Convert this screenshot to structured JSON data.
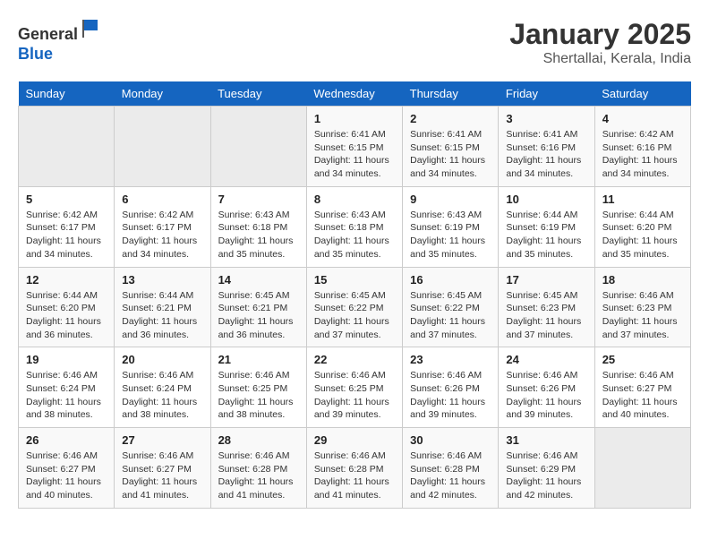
{
  "header": {
    "logo_line1": "General",
    "logo_line2": "Blue",
    "month_title": "January 2025",
    "subtitle": "Shertallai, Kerala, India"
  },
  "days_of_week": [
    "Sunday",
    "Monday",
    "Tuesday",
    "Wednesday",
    "Thursday",
    "Friday",
    "Saturday"
  ],
  "weeks": [
    [
      {
        "day": "",
        "sunrise": "",
        "sunset": "",
        "daylight": ""
      },
      {
        "day": "",
        "sunrise": "",
        "sunset": "",
        "daylight": ""
      },
      {
        "day": "",
        "sunrise": "",
        "sunset": "",
        "daylight": ""
      },
      {
        "day": "1",
        "sunrise": "Sunrise: 6:41 AM",
        "sunset": "Sunset: 6:15 PM",
        "daylight": "Daylight: 11 hours and 34 minutes."
      },
      {
        "day": "2",
        "sunrise": "Sunrise: 6:41 AM",
        "sunset": "Sunset: 6:15 PM",
        "daylight": "Daylight: 11 hours and 34 minutes."
      },
      {
        "day": "3",
        "sunrise": "Sunrise: 6:41 AM",
        "sunset": "Sunset: 6:16 PM",
        "daylight": "Daylight: 11 hours and 34 minutes."
      },
      {
        "day": "4",
        "sunrise": "Sunrise: 6:42 AM",
        "sunset": "Sunset: 6:16 PM",
        "daylight": "Daylight: 11 hours and 34 minutes."
      }
    ],
    [
      {
        "day": "5",
        "sunrise": "Sunrise: 6:42 AM",
        "sunset": "Sunset: 6:17 PM",
        "daylight": "Daylight: 11 hours and 34 minutes."
      },
      {
        "day": "6",
        "sunrise": "Sunrise: 6:42 AM",
        "sunset": "Sunset: 6:17 PM",
        "daylight": "Daylight: 11 hours and 34 minutes."
      },
      {
        "day": "7",
        "sunrise": "Sunrise: 6:43 AM",
        "sunset": "Sunset: 6:18 PM",
        "daylight": "Daylight: 11 hours and 35 minutes."
      },
      {
        "day": "8",
        "sunrise": "Sunrise: 6:43 AM",
        "sunset": "Sunset: 6:18 PM",
        "daylight": "Daylight: 11 hours and 35 minutes."
      },
      {
        "day": "9",
        "sunrise": "Sunrise: 6:43 AM",
        "sunset": "Sunset: 6:19 PM",
        "daylight": "Daylight: 11 hours and 35 minutes."
      },
      {
        "day": "10",
        "sunrise": "Sunrise: 6:44 AM",
        "sunset": "Sunset: 6:19 PM",
        "daylight": "Daylight: 11 hours and 35 minutes."
      },
      {
        "day": "11",
        "sunrise": "Sunrise: 6:44 AM",
        "sunset": "Sunset: 6:20 PM",
        "daylight": "Daylight: 11 hours and 35 minutes."
      }
    ],
    [
      {
        "day": "12",
        "sunrise": "Sunrise: 6:44 AM",
        "sunset": "Sunset: 6:20 PM",
        "daylight": "Daylight: 11 hours and 36 minutes."
      },
      {
        "day": "13",
        "sunrise": "Sunrise: 6:44 AM",
        "sunset": "Sunset: 6:21 PM",
        "daylight": "Daylight: 11 hours and 36 minutes."
      },
      {
        "day": "14",
        "sunrise": "Sunrise: 6:45 AM",
        "sunset": "Sunset: 6:21 PM",
        "daylight": "Daylight: 11 hours and 36 minutes."
      },
      {
        "day": "15",
        "sunrise": "Sunrise: 6:45 AM",
        "sunset": "Sunset: 6:22 PM",
        "daylight": "Daylight: 11 hours and 37 minutes."
      },
      {
        "day": "16",
        "sunrise": "Sunrise: 6:45 AM",
        "sunset": "Sunset: 6:22 PM",
        "daylight": "Daylight: 11 hours and 37 minutes."
      },
      {
        "day": "17",
        "sunrise": "Sunrise: 6:45 AM",
        "sunset": "Sunset: 6:23 PM",
        "daylight": "Daylight: 11 hours and 37 minutes."
      },
      {
        "day": "18",
        "sunrise": "Sunrise: 6:46 AM",
        "sunset": "Sunset: 6:23 PM",
        "daylight": "Daylight: 11 hours and 37 minutes."
      }
    ],
    [
      {
        "day": "19",
        "sunrise": "Sunrise: 6:46 AM",
        "sunset": "Sunset: 6:24 PM",
        "daylight": "Daylight: 11 hours and 38 minutes."
      },
      {
        "day": "20",
        "sunrise": "Sunrise: 6:46 AM",
        "sunset": "Sunset: 6:24 PM",
        "daylight": "Daylight: 11 hours and 38 minutes."
      },
      {
        "day": "21",
        "sunrise": "Sunrise: 6:46 AM",
        "sunset": "Sunset: 6:25 PM",
        "daylight": "Daylight: 11 hours and 38 minutes."
      },
      {
        "day": "22",
        "sunrise": "Sunrise: 6:46 AM",
        "sunset": "Sunset: 6:25 PM",
        "daylight": "Daylight: 11 hours and 39 minutes."
      },
      {
        "day": "23",
        "sunrise": "Sunrise: 6:46 AM",
        "sunset": "Sunset: 6:26 PM",
        "daylight": "Daylight: 11 hours and 39 minutes."
      },
      {
        "day": "24",
        "sunrise": "Sunrise: 6:46 AM",
        "sunset": "Sunset: 6:26 PM",
        "daylight": "Daylight: 11 hours and 39 minutes."
      },
      {
        "day": "25",
        "sunrise": "Sunrise: 6:46 AM",
        "sunset": "Sunset: 6:27 PM",
        "daylight": "Daylight: 11 hours and 40 minutes."
      }
    ],
    [
      {
        "day": "26",
        "sunrise": "Sunrise: 6:46 AM",
        "sunset": "Sunset: 6:27 PM",
        "daylight": "Daylight: 11 hours and 40 minutes."
      },
      {
        "day": "27",
        "sunrise": "Sunrise: 6:46 AM",
        "sunset": "Sunset: 6:27 PM",
        "daylight": "Daylight: 11 hours and 41 minutes."
      },
      {
        "day": "28",
        "sunrise": "Sunrise: 6:46 AM",
        "sunset": "Sunset: 6:28 PM",
        "daylight": "Daylight: 11 hours and 41 minutes."
      },
      {
        "day": "29",
        "sunrise": "Sunrise: 6:46 AM",
        "sunset": "Sunset: 6:28 PM",
        "daylight": "Daylight: 11 hours and 41 minutes."
      },
      {
        "day": "30",
        "sunrise": "Sunrise: 6:46 AM",
        "sunset": "Sunset: 6:28 PM",
        "daylight": "Daylight: 11 hours and 42 minutes."
      },
      {
        "day": "31",
        "sunrise": "Sunrise: 6:46 AM",
        "sunset": "Sunset: 6:29 PM",
        "daylight": "Daylight: 11 hours and 42 minutes."
      },
      {
        "day": "",
        "sunrise": "",
        "sunset": "",
        "daylight": ""
      }
    ]
  ]
}
